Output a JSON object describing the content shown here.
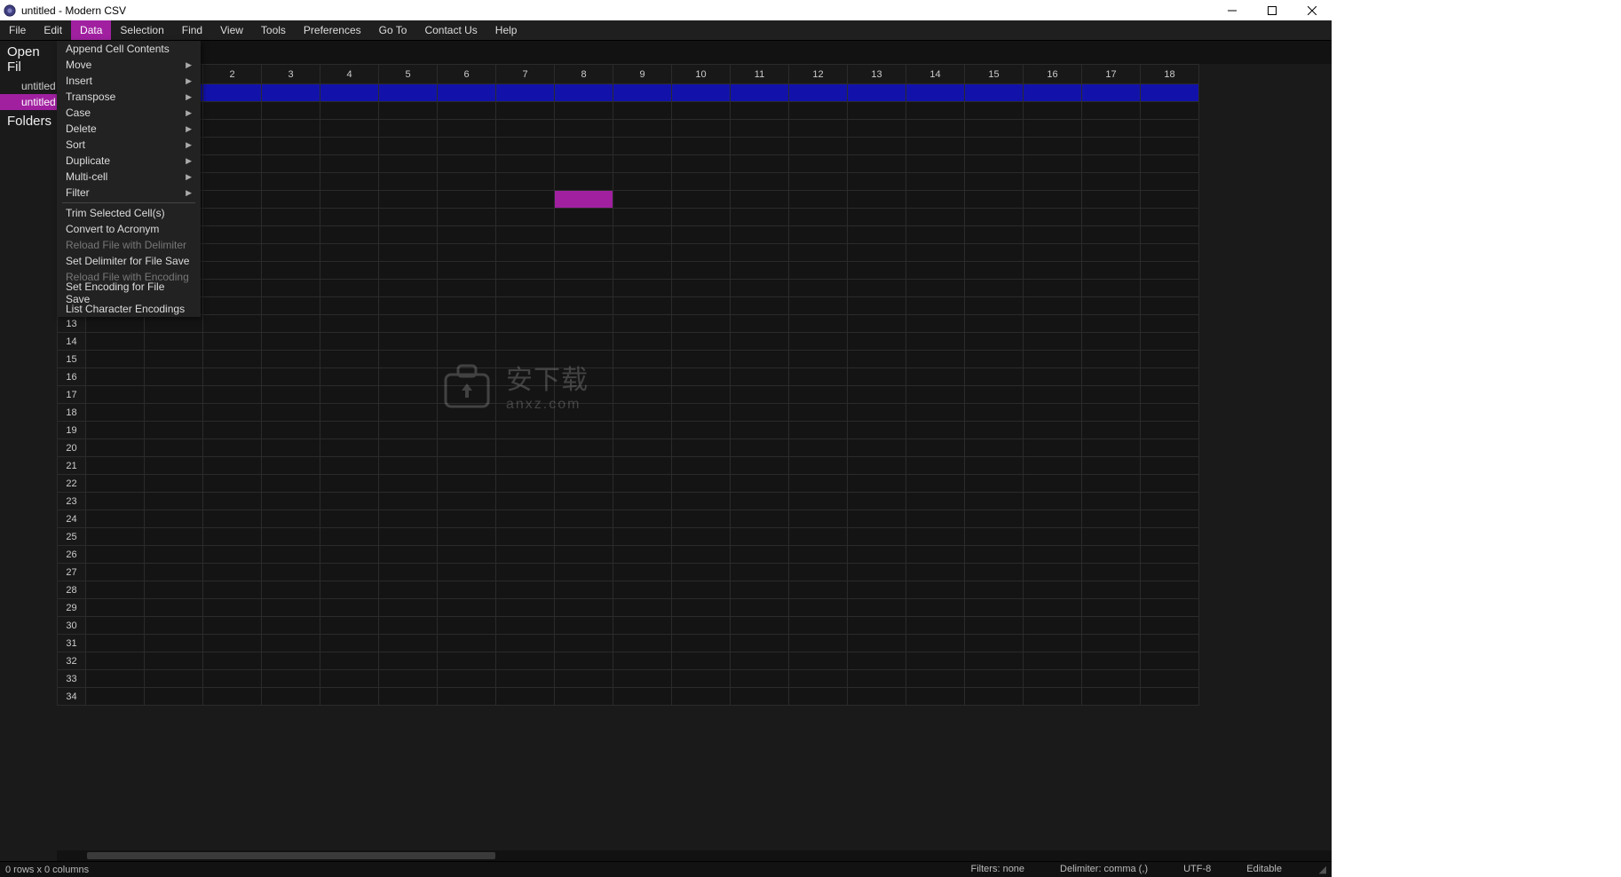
{
  "titlebar": {
    "title": "untitled - Modern CSV"
  },
  "menubar": {
    "items": [
      "File",
      "Edit",
      "Data",
      "Selection",
      "Find",
      "View",
      "Tools",
      "Preferences",
      "Go To",
      "Contact Us",
      "Help"
    ],
    "active_index": 2
  },
  "sidebar": {
    "open_files_label": "Open Fil",
    "files": [
      {
        "name": "untitled",
        "selected": false
      },
      {
        "name": "untitled",
        "selected": true
      }
    ],
    "folders_label": "Folders"
  },
  "dropdown": {
    "items": [
      {
        "label": "Append Cell Contents",
        "submenu": false,
        "disabled": false
      },
      {
        "label": "Move",
        "submenu": true,
        "disabled": false
      },
      {
        "label": "Insert",
        "submenu": true,
        "disabled": false
      },
      {
        "label": "Transpose",
        "submenu": true,
        "disabled": false
      },
      {
        "label": "Case",
        "submenu": true,
        "disabled": false
      },
      {
        "label": "Delete",
        "submenu": true,
        "disabled": false
      },
      {
        "label": "Sort",
        "submenu": true,
        "disabled": false
      },
      {
        "label": "Duplicate",
        "submenu": true,
        "disabled": false
      },
      {
        "label": "Multi-cell",
        "submenu": true,
        "disabled": false
      },
      {
        "label": "Filter",
        "submenu": true,
        "disabled": false
      },
      {
        "separator": true
      },
      {
        "label": "Trim Selected Cell(s)",
        "submenu": false,
        "disabled": false
      },
      {
        "label": "Convert to Acronym",
        "submenu": false,
        "disabled": false
      },
      {
        "label": "Reload File with Delimiter",
        "submenu": false,
        "disabled": true
      },
      {
        "label": "Set Delimiter for File Save",
        "submenu": false,
        "disabled": false
      },
      {
        "label": "Reload File with Encoding",
        "submenu": false,
        "disabled": true
      },
      {
        "label": "Set Encoding for File Save",
        "submenu": false,
        "disabled": false
      },
      {
        "label": "List Character Encodings",
        "submenu": false,
        "disabled": false
      }
    ]
  },
  "tabs": {
    "items": [
      {
        "label": "untitled",
        "active": false
      },
      {
        "label": "untitled",
        "active": true
      }
    ]
  },
  "grid": {
    "columns": 19,
    "rows": 35,
    "selected_row": 0,
    "active_cell": {
      "row": 6,
      "col": 8
    }
  },
  "watermark": {
    "brand_cn": "安下载",
    "brand_url": "anxz.com"
  },
  "statusbar": {
    "left": "0 rows x 0 columns",
    "filters": "Filters: none",
    "delimiter": "Delimiter: comma (,)",
    "encoding": "UTF-8",
    "mode": "Editable"
  }
}
